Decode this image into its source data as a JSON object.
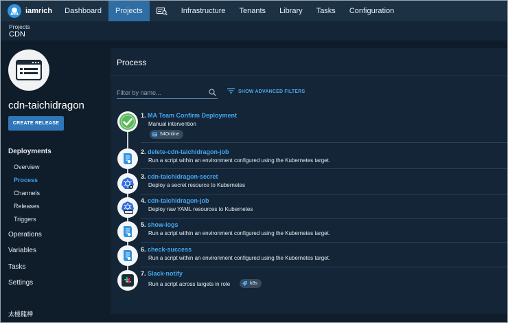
{
  "nav": {
    "user": "iamrich",
    "items": [
      "Dashboard",
      "Projects",
      "Infrastructure",
      "Tenants",
      "Library",
      "Tasks",
      "Configuration"
    ],
    "active": "Projects"
  },
  "breadcrumb": {
    "parent": "Projects",
    "title": "CDN"
  },
  "sidebar": {
    "project_name": "cdn-taichidragon",
    "create_release": "CREATE RELEASE",
    "deployments": "Deployments",
    "sub_items": [
      "Overview",
      "Process",
      "Channels",
      "Releases",
      "Triggers"
    ],
    "active_sub": "Process",
    "sections": [
      "Operations",
      "Variables",
      "Tasks",
      "Settings"
    ],
    "footer": "太極龍神"
  },
  "process": {
    "title": "Process",
    "filter_placeholder": "Filter by name...",
    "advanced_filters": "SHOW ADVANCED FILTERS",
    "steps": [
      {
        "num": "1.",
        "name": "MA Team Confirm Deployment",
        "desc": "Manual intervention",
        "icon": "check-icon",
        "chip": "54Online"
      },
      {
        "num": "2.",
        "name": "delete-cdn-taichidragon-job",
        "desc": "Run a script within an environment configured using the Kubernetes target.",
        "icon": "script-icon"
      },
      {
        "num": "3.",
        "name": "cdn-taichidragon-secret",
        "desc": "Deploy a secret resource to Kubernetes",
        "icon": "kubernetes-secret-icon"
      },
      {
        "num": "4.",
        "name": "cdn-taichidragon-job",
        "desc": "Deploy raw YAML resources to Kubernetes",
        "icon": "kubernetes-yaml-icon"
      },
      {
        "num": "5.",
        "name": "show-logs",
        "desc": "Run a script within an environment configured using the Kubernetes target.",
        "icon": "script-icon"
      },
      {
        "num": "6.",
        "name": "check-success",
        "desc": "Run a script within an environment configured using the Kubernetes target.",
        "icon": "script-icon"
      },
      {
        "num": "7.",
        "name": "Slack-notify",
        "desc": "Run a script across targets in role",
        "icon": "slack-icon",
        "chip": "k8s"
      }
    ]
  },
  "colors": {
    "accent": "#2f6ea5",
    "link": "#47a6f0",
    "success": "#5cb85c",
    "panel": "#132536"
  }
}
